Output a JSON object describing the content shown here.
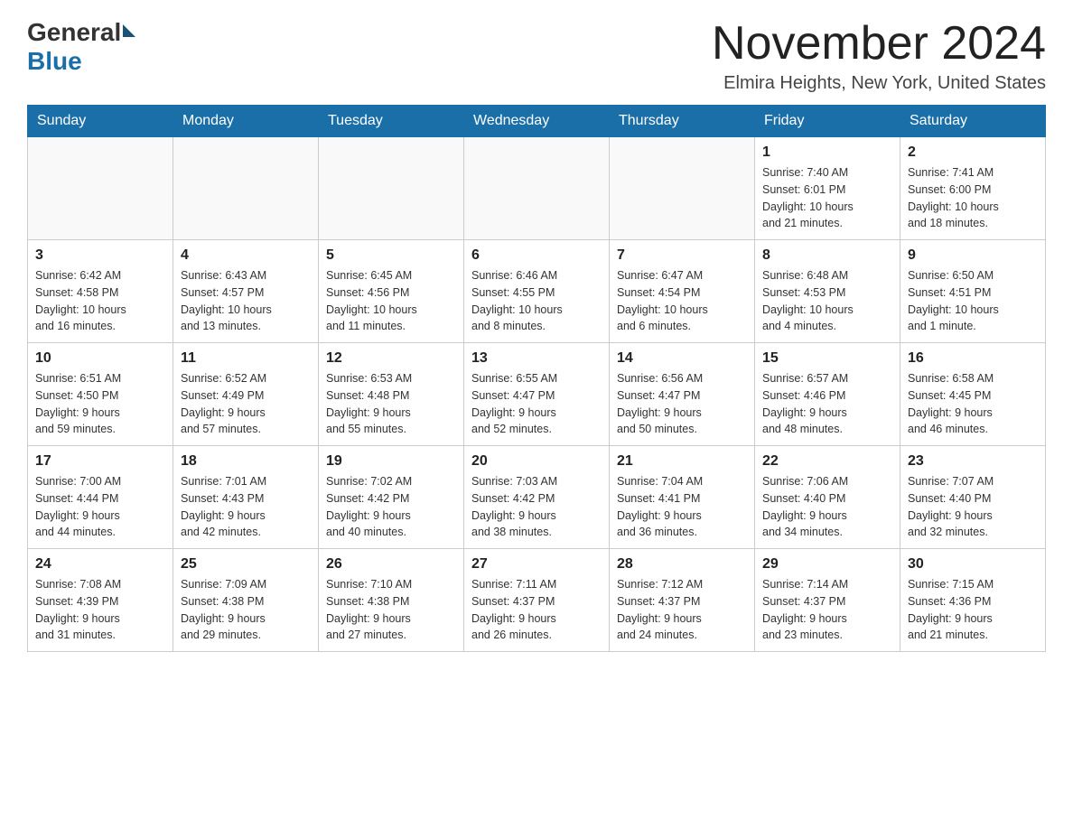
{
  "header": {
    "logo_general": "General",
    "logo_blue": "Blue",
    "month_title": "November 2024",
    "location": "Elmira Heights, New York, United States"
  },
  "days_of_week": [
    "Sunday",
    "Monday",
    "Tuesday",
    "Wednesday",
    "Thursday",
    "Friday",
    "Saturday"
  ],
  "weeks": [
    [
      {
        "day": "",
        "info": ""
      },
      {
        "day": "",
        "info": ""
      },
      {
        "day": "",
        "info": ""
      },
      {
        "day": "",
        "info": ""
      },
      {
        "day": "",
        "info": ""
      },
      {
        "day": "1",
        "info": "Sunrise: 7:40 AM\nSunset: 6:01 PM\nDaylight: 10 hours\nand 21 minutes."
      },
      {
        "day": "2",
        "info": "Sunrise: 7:41 AM\nSunset: 6:00 PM\nDaylight: 10 hours\nand 18 minutes."
      }
    ],
    [
      {
        "day": "3",
        "info": "Sunrise: 6:42 AM\nSunset: 4:58 PM\nDaylight: 10 hours\nand 16 minutes."
      },
      {
        "day": "4",
        "info": "Sunrise: 6:43 AM\nSunset: 4:57 PM\nDaylight: 10 hours\nand 13 minutes."
      },
      {
        "day": "5",
        "info": "Sunrise: 6:45 AM\nSunset: 4:56 PM\nDaylight: 10 hours\nand 11 minutes."
      },
      {
        "day": "6",
        "info": "Sunrise: 6:46 AM\nSunset: 4:55 PM\nDaylight: 10 hours\nand 8 minutes."
      },
      {
        "day": "7",
        "info": "Sunrise: 6:47 AM\nSunset: 4:54 PM\nDaylight: 10 hours\nand 6 minutes."
      },
      {
        "day": "8",
        "info": "Sunrise: 6:48 AM\nSunset: 4:53 PM\nDaylight: 10 hours\nand 4 minutes."
      },
      {
        "day": "9",
        "info": "Sunrise: 6:50 AM\nSunset: 4:51 PM\nDaylight: 10 hours\nand 1 minute."
      }
    ],
    [
      {
        "day": "10",
        "info": "Sunrise: 6:51 AM\nSunset: 4:50 PM\nDaylight: 9 hours\nand 59 minutes."
      },
      {
        "day": "11",
        "info": "Sunrise: 6:52 AM\nSunset: 4:49 PM\nDaylight: 9 hours\nand 57 minutes."
      },
      {
        "day": "12",
        "info": "Sunrise: 6:53 AM\nSunset: 4:48 PM\nDaylight: 9 hours\nand 55 minutes."
      },
      {
        "day": "13",
        "info": "Sunrise: 6:55 AM\nSunset: 4:47 PM\nDaylight: 9 hours\nand 52 minutes."
      },
      {
        "day": "14",
        "info": "Sunrise: 6:56 AM\nSunset: 4:47 PM\nDaylight: 9 hours\nand 50 minutes."
      },
      {
        "day": "15",
        "info": "Sunrise: 6:57 AM\nSunset: 4:46 PM\nDaylight: 9 hours\nand 48 minutes."
      },
      {
        "day": "16",
        "info": "Sunrise: 6:58 AM\nSunset: 4:45 PM\nDaylight: 9 hours\nand 46 minutes."
      }
    ],
    [
      {
        "day": "17",
        "info": "Sunrise: 7:00 AM\nSunset: 4:44 PM\nDaylight: 9 hours\nand 44 minutes."
      },
      {
        "day": "18",
        "info": "Sunrise: 7:01 AM\nSunset: 4:43 PM\nDaylight: 9 hours\nand 42 minutes."
      },
      {
        "day": "19",
        "info": "Sunrise: 7:02 AM\nSunset: 4:42 PM\nDaylight: 9 hours\nand 40 minutes."
      },
      {
        "day": "20",
        "info": "Sunrise: 7:03 AM\nSunset: 4:42 PM\nDaylight: 9 hours\nand 38 minutes."
      },
      {
        "day": "21",
        "info": "Sunrise: 7:04 AM\nSunset: 4:41 PM\nDaylight: 9 hours\nand 36 minutes."
      },
      {
        "day": "22",
        "info": "Sunrise: 7:06 AM\nSunset: 4:40 PM\nDaylight: 9 hours\nand 34 minutes."
      },
      {
        "day": "23",
        "info": "Sunrise: 7:07 AM\nSunset: 4:40 PM\nDaylight: 9 hours\nand 32 minutes."
      }
    ],
    [
      {
        "day": "24",
        "info": "Sunrise: 7:08 AM\nSunset: 4:39 PM\nDaylight: 9 hours\nand 31 minutes."
      },
      {
        "day": "25",
        "info": "Sunrise: 7:09 AM\nSunset: 4:38 PM\nDaylight: 9 hours\nand 29 minutes."
      },
      {
        "day": "26",
        "info": "Sunrise: 7:10 AM\nSunset: 4:38 PM\nDaylight: 9 hours\nand 27 minutes."
      },
      {
        "day": "27",
        "info": "Sunrise: 7:11 AM\nSunset: 4:37 PM\nDaylight: 9 hours\nand 26 minutes."
      },
      {
        "day": "28",
        "info": "Sunrise: 7:12 AM\nSunset: 4:37 PM\nDaylight: 9 hours\nand 24 minutes."
      },
      {
        "day": "29",
        "info": "Sunrise: 7:14 AM\nSunset: 4:37 PM\nDaylight: 9 hours\nand 23 minutes."
      },
      {
        "day": "30",
        "info": "Sunrise: 7:15 AM\nSunset: 4:36 PM\nDaylight: 9 hours\nand 21 minutes."
      }
    ]
  ]
}
